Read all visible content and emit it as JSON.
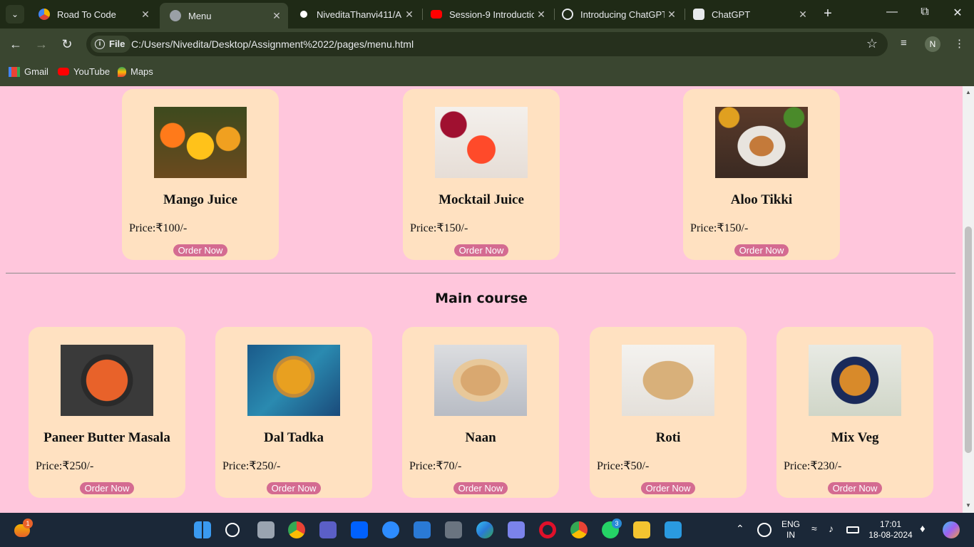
{
  "browser": {
    "tabs": [
      {
        "title": "Road To Code",
        "favicon": "road-to-code-icon",
        "active": false
      },
      {
        "title": "Menu",
        "favicon": "globe-icon",
        "active": true
      },
      {
        "title": "NiveditaThanvi411/A",
        "favicon": "github-icon",
        "active": false
      },
      {
        "title": "Session-9 Introductio",
        "favicon": "youtube-icon",
        "active": false
      },
      {
        "title": "Introducing ChatGPT",
        "favicon": "openai-icon",
        "active": false
      },
      {
        "title": "ChatGPT",
        "favicon": "openai-icon",
        "active": false
      }
    ],
    "file_chip": "File",
    "url": "C:/Users/Nivedita/Desktop/Assignment%2022/pages/menu.html",
    "profile_initial": "N",
    "bookmarks": [
      "Gmail",
      "YouTube",
      "Maps"
    ]
  },
  "page": {
    "top_row": [
      {
        "name": "Mango Juice",
        "price": "Price:₹100/-",
        "button": "Order Now",
        "image": "mango-juice-photo"
      },
      {
        "name": "Mocktail Juice",
        "price": "Price:₹150/-",
        "button": "Order Now",
        "image": "mocktail-juice-photo"
      },
      {
        "name": "Aloo Tikki",
        "price": "Price:₹150/-",
        "button": "Order Now",
        "image": "aloo-tikki-photo"
      }
    ],
    "section_title": "Main course",
    "main_course": [
      {
        "name": "Paneer Butter Masala",
        "price": "Price:₹250/-",
        "button": "Order Now",
        "image": "paneer-photo"
      },
      {
        "name": "Dal Tadka",
        "price": "Price:₹250/-",
        "button": "Order Now",
        "image": "dal-tadka-photo"
      },
      {
        "name": "Naan",
        "price": "Price:₹70/-",
        "button": "Order Now",
        "image": "naan-photo"
      },
      {
        "name": "Roti",
        "price": "Price:₹50/-",
        "button": "Order Now",
        "image": "roti-photo"
      },
      {
        "name": "Mix Veg",
        "price": "Price:₹230/-",
        "button": "Order Now",
        "image": "mix-veg-photo"
      }
    ]
  },
  "taskbar": {
    "weather_badge": "1",
    "whatsapp_badge": "3",
    "language_line1": "ENG",
    "language_line2": "IN",
    "time": "17:01",
    "date": "18-08-2024"
  },
  "colors": {
    "page_bg": "#ffc6dc",
    "card_bg": "#ffe1c1",
    "button_bg": "#d46b91",
    "browser_frame": "#3a4630"
  }
}
